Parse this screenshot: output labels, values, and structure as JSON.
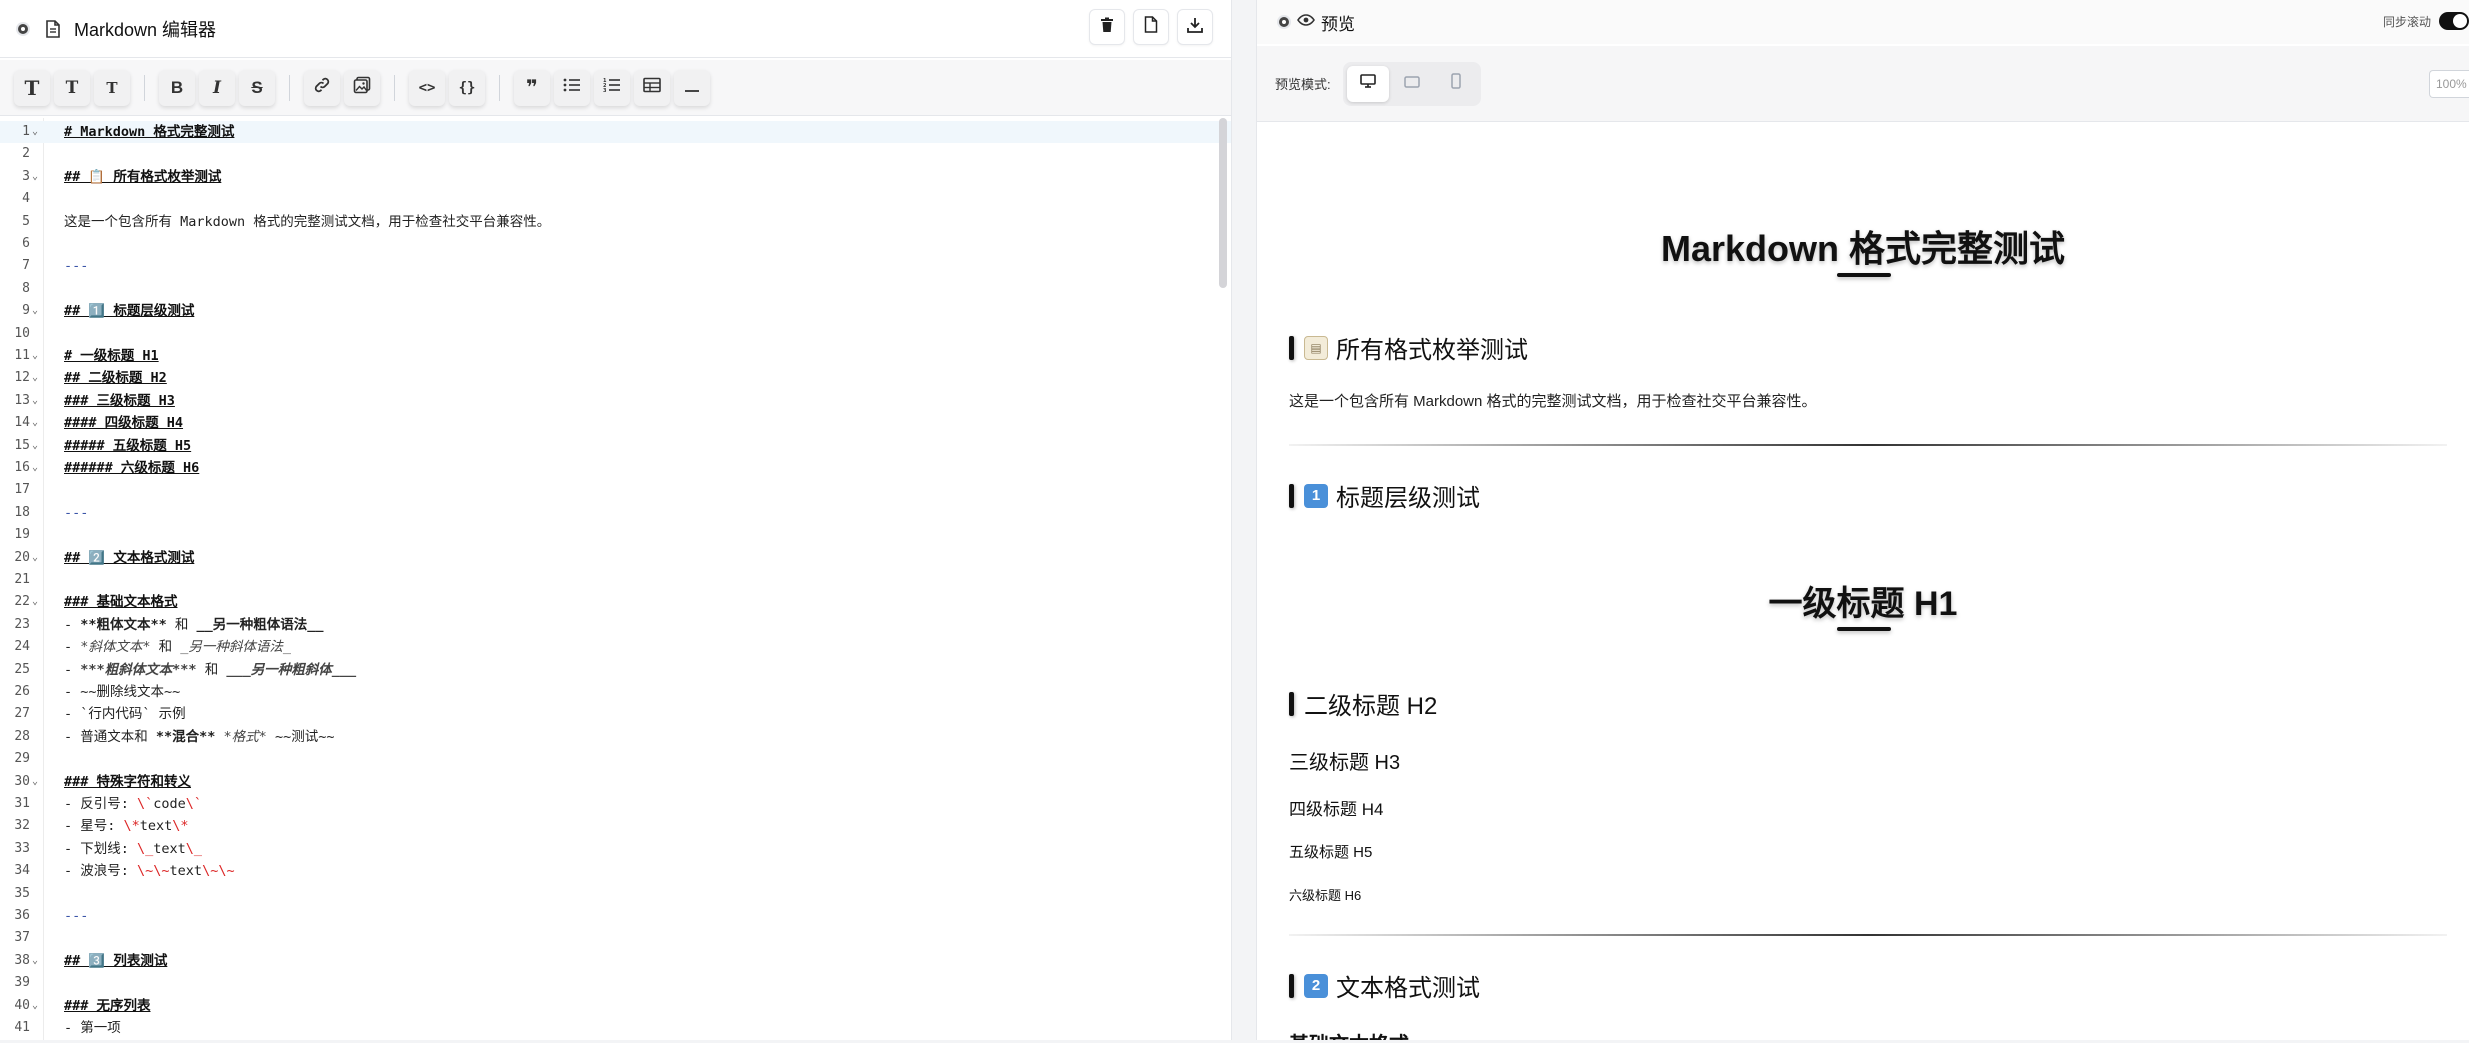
{
  "editor": {
    "title": "Markdown 编辑器",
    "actions": [
      {
        "name": "clear-button",
        "icon": "trash-icon"
      },
      {
        "name": "new-file-button",
        "icon": "file-icon"
      },
      {
        "name": "download-button",
        "icon": "download-icon"
      }
    ],
    "toolbar": {
      "h1": "T",
      "h2": "T",
      "h3": "T",
      "bold": "B",
      "italic": "I",
      "strike": "S",
      "code_inline": "<>",
      "code_block": "{}",
      "quote": "❞"
    },
    "lines": [
      {
        "n": "1",
        "fold": true,
        "kind": "heading",
        "text": "# Markdown 格式完整测试"
      },
      {
        "n": "2",
        "text": ""
      },
      {
        "n": "3",
        "fold": true,
        "kind": "heading",
        "text": "## 📋 所有格式枚举测试"
      },
      {
        "n": "4",
        "text": ""
      },
      {
        "n": "5",
        "text": "这是一个包含所有 Markdown 格式的完整测试文档，用于检查社交平台兼容性。"
      },
      {
        "n": "6",
        "text": ""
      },
      {
        "n": "7",
        "kind": "hr",
        "text": "---"
      },
      {
        "n": "8",
        "text": ""
      },
      {
        "n": "9",
        "fold": true,
        "kind": "heading",
        "text": "## 1️⃣ 标题层级测试"
      },
      {
        "n": "10",
        "text": ""
      },
      {
        "n": "11",
        "fold": true,
        "kind": "heading",
        "text": "# 一级标题 H1"
      },
      {
        "n": "12",
        "fold": true,
        "kind": "heading",
        "text": "## 二级标题 H2"
      },
      {
        "n": "13",
        "fold": true,
        "kind": "heading",
        "text": "### 三级标题 H3"
      },
      {
        "n": "14",
        "fold": true,
        "kind": "heading",
        "text": "#### 四级标题 H4"
      },
      {
        "n": "15",
        "fold": true,
        "kind": "heading",
        "text": "##### 五级标题 H5"
      },
      {
        "n": "16",
        "fold": true,
        "kind": "heading",
        "text": "###### 六级标题 H6"
      },
      {
        "n": "17",
        "text": ""
      },
      {
        "n": "18",
        "kind": "hr",
        "text": "---"
      },
      {
        "n": "19",
        "text": ""
      },
      {
        "n": "20",
        "fold": true,
        "kind": "heading",
        "text": "## 2️⃣ 文本格式测试"
      },
      {
        "n": "21",
        "text": ""
      },
      {
        "n": "22",
        "fold": true,
        "kind": "heading",
        "text": "### 基础文本格式"
      },
      {
        "n": "23",
        "text": "- **粗体文本** 和 __另一种粗体语法__"
      },
      {
        "n": "24",
        "text": "- *斜体文本* 和 _另一种斜体语法_"
      },
      {
        "n": "25",
        "text": "- ***粗斜体文本*** 和 ___另一种粗斜体___"
      },
      {
        "n": "26",
        "text": "- ~~删除线文本~~"
      },
      {
        "n": "27",
        "text": "- `行内代码` 示例"
      },
      {
        "n": "28",
        "text": "- 普通文本和 **混合** *格式* ~~测试~~"
      },
      {
        "n": "29",
        "text": ""
      },
      {
        "n": "30",
        "fold": true,
        "kind": "heading",
        "text": "### 特殊字符和转义"
      },
      {
        "n": "31",
        "text": "- 反引号: \\`code\\`"
      },
      {
        "n": "32",
        "text": "- 星号: \\*text\\*"
      },
      {
        "n": "33",
        "text": "- 下划线: \\_text\\_"
      },
      {
        "n": "34",
        "text": "- 波浪号: \\~\\~text\\~\\~"
      },
      {
        "n": "35",
        "text": ""
      },
      {
        "n": "36",
        "kind": "hr",
        "text": "---"
      },
      {
        "n": "37",
        "text": ""
      },
      {
        "n": "38",
        "fold": true,
        "kind": "heading",
        "text": "## 3️⃣ 列表测试"
      },
      {
        "n": "39",
        "text": ""
      },
      {
        "n": "40",
        "fold": true,
        "kind": "heading",
        "text": "### 无序列表"
      },
      {
        "n": "41",
        "text": "- 第一项"
      }
    ]
  },
  "preview": {
    "title": "预览",
    "sync_label": "同步滚动",
    "mode_label": "预览模式:",
    "zoom": "100%",
    "doc_title": "Markdown 格式完整测试",
    "section1": {
      "emoji": "📋",
      "title": "所有格式枚举测试"
    },
    "intro": "这是一个包含所有 Markdown 格式的完整测试文档，用于检查社交平台兼容性。",
    "section2": {
      "emoji": "1",
      "title": "标题层级测试"
    },
    "h1": "一级标题 H1",
    "h2": "二级标题 H2",
    "h3": "三级标题 H3",
    "h4": "四级标题 H4",
    "h5": "五级标题 H5",
    "h6": "六级标题 H6",
    "section3": {
      "emoji": "2",
      "title": "文本格式测试"
    },
    "next_heading": "基础文本格式"
  },
  "colors": {
    "accent": "#111111",
    "keycap": "#4a90d9",
    "escape": "#dc2626",
    "hr_code": "#3b55a8"
  }
}
